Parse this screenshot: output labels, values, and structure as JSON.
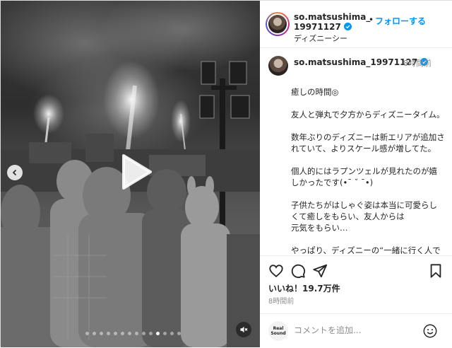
{
  "post": {
    "username_line1": "so.matsushima_",
    "username_line2": "19971127",
    "follow_label": "フォローする",
    "dot_separator": "•",
    "location": "ディズニーシー"
  },
  "caption": {
    "username": "so.matsushima_19971127",
    "time": "8時間前",
    "paragraphs": [
      "癒しの時間◎",
      "友人と弾丸で夕方からディズニータイム。",
      "数年ぶりのディズニーは新エリアが追加されていて、よりスケール感が増してた。",
      "個人的にはラプンツェルが見れたのが嬉しかったです(•¯ ˘ ¯•)",
      "子供たちがはしゃぐ姿は本当に可愛らしくて癒しをもらい、友人からは\n元気をもらい…",
      "やっぱり、ディズニーの“一緒に行く人で楽しさが決まる”って\n本当だ"
    ]
  },
  "actions": {
    "likes": "いいね！19.7万件",
    "posted": "8時間前"
  },
  "comment": {
    "placeholder": "コメントを追加...",
    "watermark_line1": "Real",
    "watermark_line2": "Sound"
  },
  "carousel": {
    "slides": 14,
    "active_index": 10
  },
  "icons": {
    "heart": "heart-icon",
    "comment": "comment-icon",
    "share": "share-icon",
    "save": "bookmark-icon",
    "emoji": "emoji-icon",
    "play": "play-icon",
    "mute": "mute-icon",
    "prev": "chevron-left-icon",
    "verified": "verified-icon"
  },
  "colors": {
    "accent": "#0095f6",
    "text": "#262626",
    "muted": "#8e8e8e",
    "divider": "#efefef"
  }
}
